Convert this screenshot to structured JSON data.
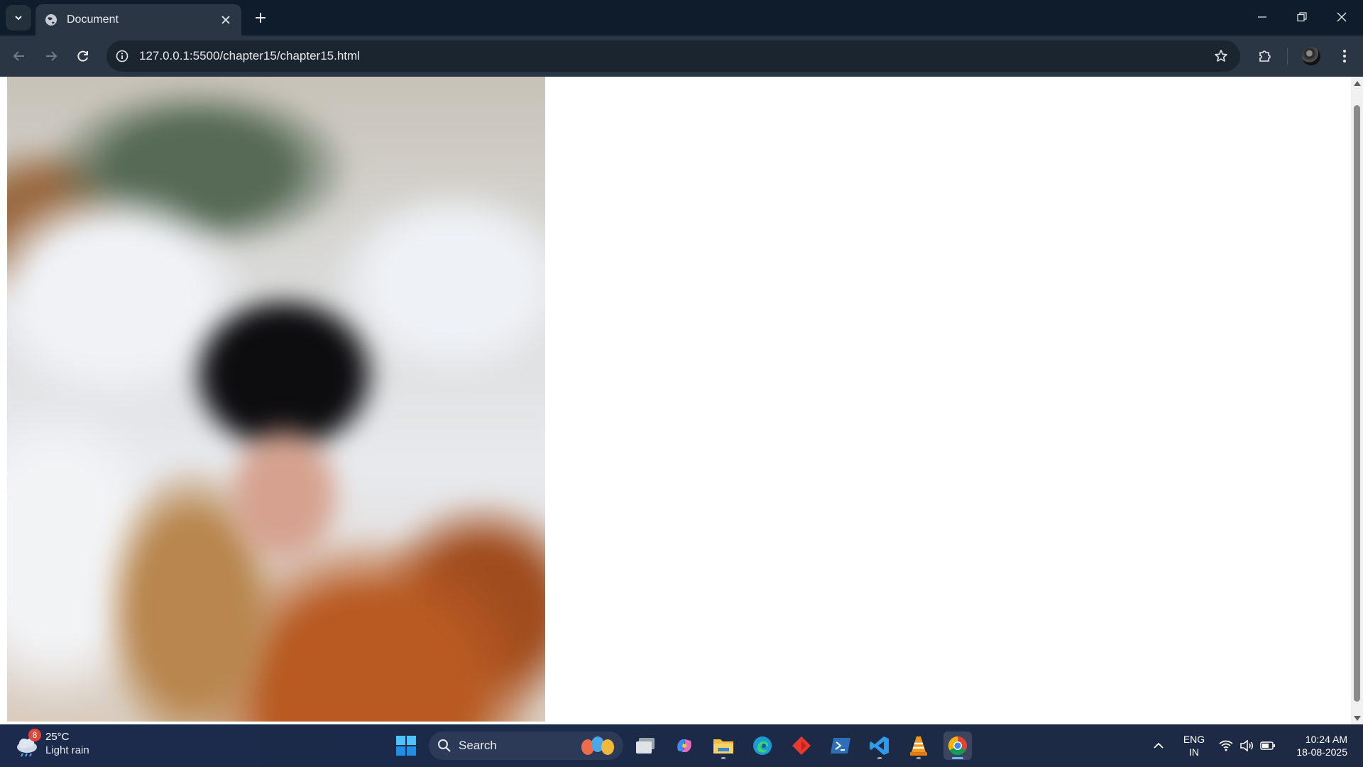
{
  "browser": {
    "tab_title": "Document",
    "url": "127.0.0.1:5500/chapter15/chapter15.html",
    "icons": {
      "tab_search": "chevron-down-icon",
      "tab_favicon": "globe-icon",
      "tab_close": "close-icon",
      "new_tab": "plus-icon",
      "back": "arrow-left-icon",
      "forward": "arrow-right-icon",
      "reload": "reload-icon",
      "site_info": "info-icon",
      "bookmark": "star-icon",
      "extensions": "puzzle-icon",
      "menu": "kebab-menu-icon"
    }
  },
  "page": {
    "image_description_alt": "blurred photo"
  },
  "taskbar": {
    "weather": {
      "badge": "8",
      "temp": "25°C",
      "condition": "Light rain"
    },
    "search_label": "Search",
    "language": {
      "line1": "ENG",
      "line2": "IN"
    },
    "clock": {
      "time": "10:24 AM",
      "date": "18-08-2025"
    },
    "apps": [
      "windows-start",
      "task-view",
      "copilot",
      "file-explorer",
      "edge",
      "git",
      "powershell",
      "vscode",
      "vlc",
      "chrome"
    ],
    "accent": "#6cb4ff"
  },
  "colors": {
    "titlebar": "#0e1c2b",
    "toolbar": "#2a3644",
    "omnibox": "#1b2530"
  }
}
